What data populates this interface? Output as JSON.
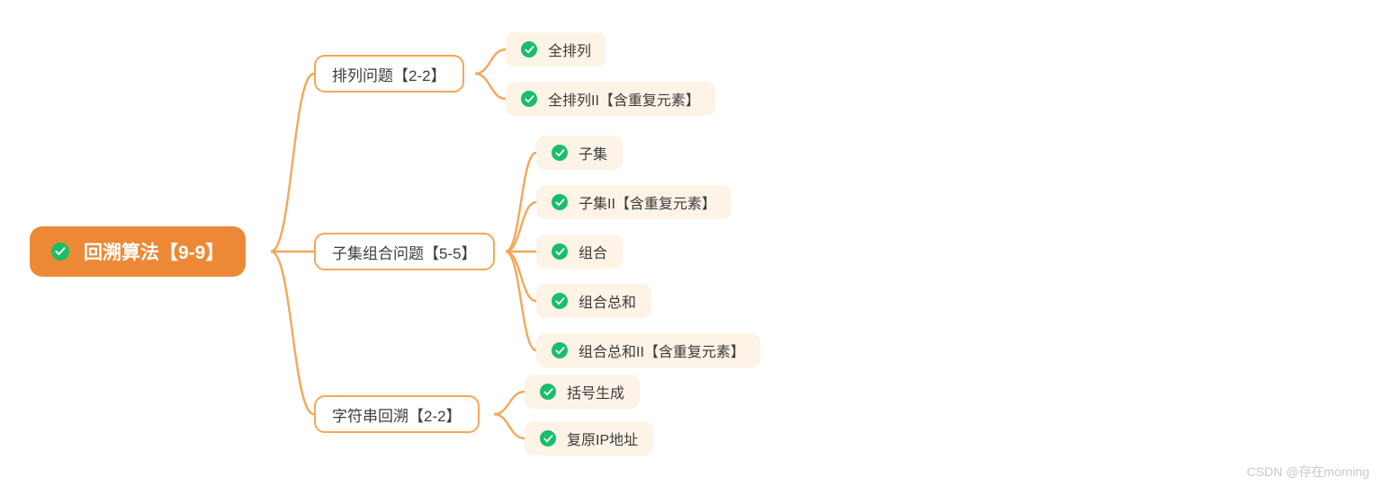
{
  "root": {
    "label": "回溯算法【9-9】"
  },
  "branches": [
    {
      "label": "排列问题【2-2】",
      "leaves": [
        {
          "label": "全排列"
        },
        {
          "label": "全排列II【含重复元素】"
        }
      ]
    },
    {
      "label": "子集组合问题【5-5】",
      "leaves": [
        {
          "label": "子集"
        },
        {
          "label": "子集II【含重复元素】"
        },
        {
          "label": "组合"
        },
        {
          "label": "组合总和"
        },
        {
          "label": "组合总和II【含重复元素】"
        }
      ]
    },
    {
      "label": "字符串回溯【2-2】",
      "leaves": [
        {
          "label": "括号生成"
        },
        {
          "label": "复原IP地址"
        }
      ]
    }
  ],
  "watermark": "CSDN @存在morning",
  "colors": {
    "accent": "#f6a757",
    "rootFill": "#ed8936",
    "leafFill": "#fdf3e6",
    "checkFill": "#19be6b"
  }
}
